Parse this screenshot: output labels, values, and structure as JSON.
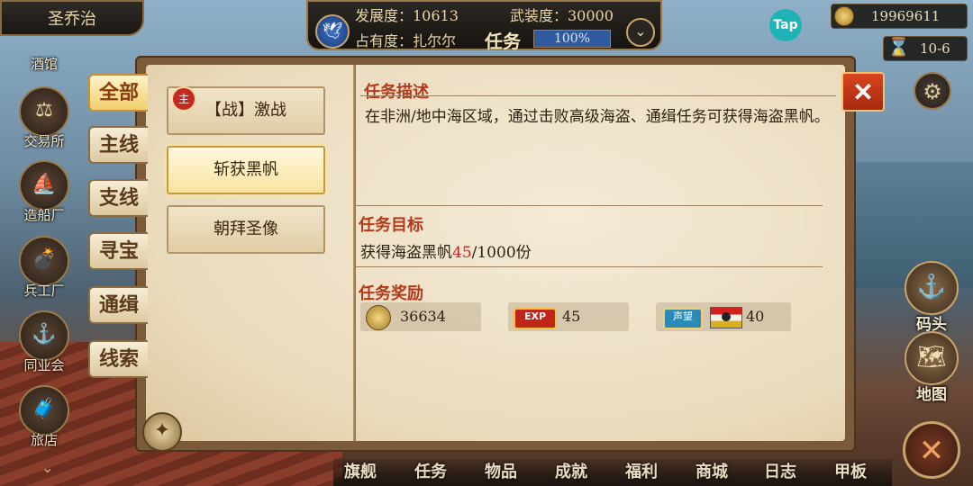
{
  "city": "圣乔治",
  "top_stats": {
    "development_label": "发展度：10613",
    "armament_label": "武装度：30000",
    "occupancy_label": "占有度：扎尔尔",
    "mission_title": "任务",
    "progress_text": "100%",
    "progress_value": 1.0
  },
  "tap_label": "Tap",
  "gold": "19969611",
  "date": "10-6",
  "left_nav": [
    {
      "label": "酒馆",
      "icon": "tavern-icon",
      "glyph": "🍺"
    },
    {
      "label": "交易所",
      "icon": "scales-icon",
      "glyph": "⚖"
    },
    {
      "label": "造船厂",
      "icon": "ship-icon",
      "glyph": "⛵"
    },
    {
      "label": "兵工厂",
      "icon": "cannon-icon",
      "glyph": "💣"
    },
    {
      "label": "同业会",
      "icon": "guild-icon",
      "glyph": "⚓"
    },
    {
      "label": "旅店",
      "icon": "inn-icon",
      "glyph": "🧳"
    }
  ],
  "categories": [
    {
      "label": "全部",
      "active": true
    },
    {
      "label": "主线",
      "active": false
    },
    {
      "label": "支线",
      "active": false
    },
    {
      "label": "寻宝",
      "active": false
    },
    {
      "label": "通缉",
      "active": false
    },
    {
      "label": "线索",
      "active": false
    }
  ],
  "quests": [
    {
      "label": "【战】激战",
      "badge": "主",
      "active": false
    },
    {
      "label": "斩获黑帆",
      "active": true
    },
    {
      "label": "朝拜圣像",
      "active": false
    }
  ],
  "detail": {
    "desc_title": "任务描述",
    "desc_text": "在非洲/地中海区域，通过击败高级海盗、通缉任务可获得海盗黑帆。",
    "goal_title": "任务目标",
    "goal_prefix": "获得海盗黑帆",
    "goal_current": "45",
    "goal_suffix": "/1000份",
    "reward_title": "任务奖励",
    "rewards": {
      "gold": "36634",
      "exp_badge": "EXP",
      "exp": "45",
      "rep_badge": "声望",
      "rep": "40"
    }
  },
  "right_nav": [
    {
      "label": "码头",
      "icon": "dock-icon",
      "glyph": "⚓"
    },
    {
      "label": "地图",
      "icon": "map-icon",
      "glyph": "🗺"
    }
  ],
  "bottom_nav": [
    "旗舰",
    "任务",
    "物品",
    "成就",
    "福利",
    "商城",
    "日志",
    "甲板"
  ],
  "colors": {
    "accent_red": "#d02020",
    "title_red": "#b33a1a",
    "active_tab_gold": "#f2cf6e"
  }
}
